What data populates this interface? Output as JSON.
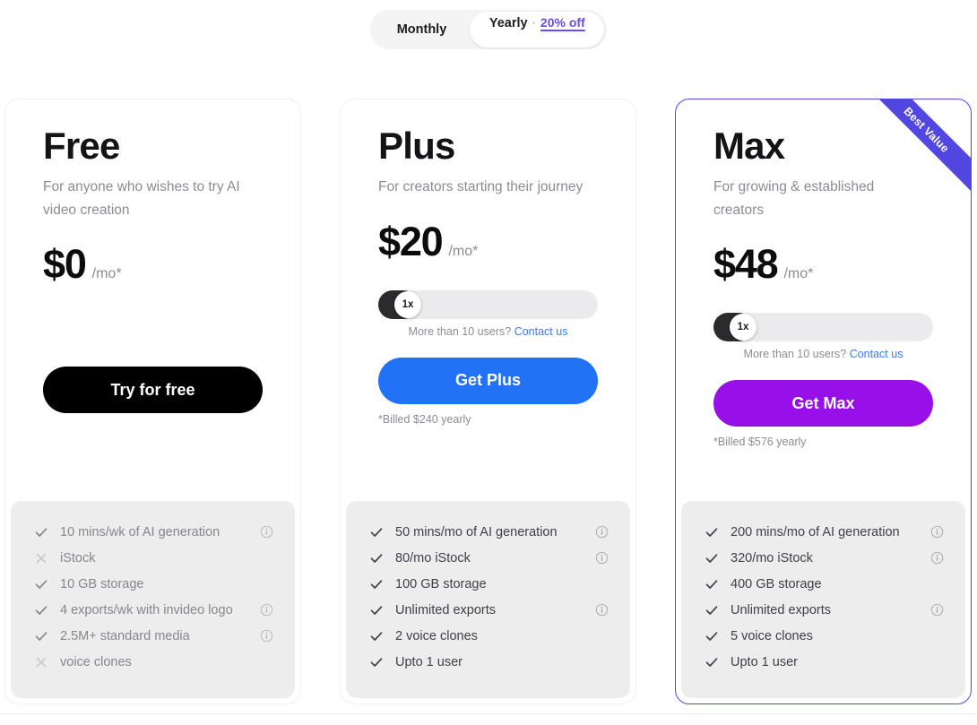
{
  "billing_toggle": {
    "monthly_label": "Monthly",
    "yearly_label": "Yearly",
    "separator": "·",
    "discount_label": "20% off",
    "selected": "Yearly"
  },
  "plans": [
    {
      "name": "Free",
      "description": "For anyone who wishes to try AI video creation",
      "price": "$0",
      "period": "/mo*",
      "has_seats_slider": false,
      "cta_label": "Try for free",
      "cta_color": "#000000",
      "billed_note": "",
      "featured": false,
      "features": [
        {
          "icon": "check-icon",
          "text": "10 mins/wk of AI generation",
          "info": true
        },
        {
          "icon": "cross-icon",
          "text": "iStock",
          "info": false
        },
        {
          "icon": "check-icon",
          "text": "10 GB storage",
          "info": false
        },
        {
          "icon": "check-icon",
          "text": "4 exports/wk with invideo logo",
          "info": true
        },
        {
          "icon": "check-icon",
          "text": "2.5M+ standard media",
          "info": true
        },
        {
          "icon": "cross-icon",
          "text": "voice clones",
          "info": false
        }
      ]
    },
    {
      "name": "Plus",
      "description": "For creators starting their journey",
      "price": "$20",
      "period": "/mo*",
      "has_seats_slider": true,
      "seats_value": "1x",
      "seats_note_text": "More than 10 users?",
      "seats_note_link": "Contact us",
      "cta_label": "Get Plus",
      "cta_color": "#2272f5",
      "billed_note": "*Billed $240 yearly",
      "featured": false,
      "features": [
        {
          "icon": "check-icon",
          "text": "50 mins/mo of AI generation",
          "info": true
        },
        {
          "icon": "check-icon",
          "text": "80/mo iStock",
          "info": true
        },
        {
          "icon": "check-icon",
          "text": "100 GB storage",
          "info": false
        },
        {
          "icon": "check-icon",
          "text": "Unlimited exports",
          "info": true
        },
        {
          "icon": "check-icon",
          "text": "2 voice clones",
          "info": false
        },
        {
          "icon": "check-icon",
          "text": "Upto 1 user",
          "info": false
        }
      ]
    },
    {
      "name": "Max",
      "description": "For growing & established creators",
      "price": "$48",
      "period": "/mo*",
      "has_seats_slider": true,
      "seats_value": "1x",
      "seats_note_text": "More than 10 users?",
      "seats_note_link": "Contact us",
      "cta_label": "Get Max",
      "cta_color": "#9810e8",
      "billed_note": "*Billed $576 yearly",
      "featured": true,
      "ribbon_label": "Best Value",
      "ribbon_color": "#5146e0",
      "features": [
        {
          "icon": "check-icon",
          "text": "200 mins/mo of AI generation",
          "info": true
        },
        {
          "icon": "check-icon",
          "text": "320/mo iStock",
          "info": true
        },
        {
          "icon": "check-icon",
          "text": "400 GB storage",
          "info": false
        },
        {
          "icon": "check-icon",
          "text": "Unlimited exports",
          "info": true
        },
        {
          "icon": "check-icon",
          "text": "5 voice clones",
          "info": false
        },
        {
          "icon": "check-icon",
          "text": "Upto 1 user",
          "info": false
        }
      ]
    }
  ]
}
